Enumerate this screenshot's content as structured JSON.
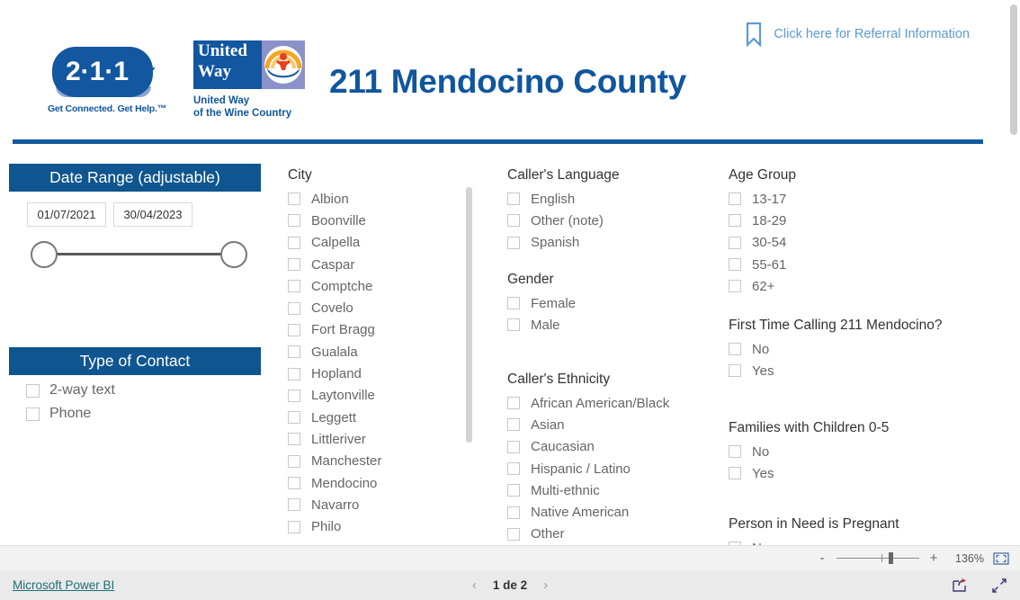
{
  "header": {
    "logo_211_text": "2·1·1",
    "logo_211_tagline": "Get Connected. Get Help.™",
    "united_way_line1": "United",
    "united_way_line2": "Way",
    "united_way_sub": "United Way\nof the Wine Country",
    "title": "211 Mendocino County",
    "referral_link": "Click here for Referral Information",
    "bookmark_icon": "bookmark-icon",
    "accent_blue": "#10569e",
    "link_blue": "#5b9bd5"
  },
  "date_range": {
    "title": "Date Range (adjustable)",
    "start": "01/07/2021",
    "end": "30/04/2023"
  },
  "type_of_contact": {
    "title": "Type of Contact",
    "options": [
      "2-way text",
      "Phone"
    ]
  },
  "city": {
    "title": "City",
    "options": [
      "Albion",
      "Boonville",
      "Calpella",
      "Caspar",
      "Comptche",
      "Covelo",
      "Fort Bragg",
      "Gualala",
      "Hopland",
      "Laytonville",
      "Leggett",
      "Littleriver",
      "Manchester",
      "Mendocino",
      "Navarro",
      "Philo"
    ]
  },
  "language": {
    "title": "Caller's Language",
    "options": [
      "English",
      "Other (note)",
      "Spanish"
    ]
  },
  "gender": {
    "title": "Gender",
    "options": [
      "Female",
      "Male"
    ]
  },
  "ethnicity": {
    "title": "Caller's Ethnicity",
    "options": [
      "African American/Black",
      "Asian",
      "Caucasian",
      "Hispanic / Latino",
      "Multi-ethnic",
      "Native American",
      "Other"
    ]
  },
  "age_group": {
    "title": "Age Group",
    "options": [
      "13-17",
      "18-29",
      "30-54",
      "55-61",
      "62+"
    ]
  },
  "first_time": {
    "title": "First Time Calling 211 Mendocino?",
    "options": [
      "No",
      "Yes"
    ]
  },
  "families": {
    "title": "Families with Children 0-5",
    "options": [
      "No",
      "Yes"
    ]
  },
  "pregnant": {
    "title": "Person in Need is Pregnant",
    "options": [
      "No"
    ]
  },
  "zoombar": {
    "minus": "-",
    "plus": "+",
    "percent": "136%",
    "fit_icon": "fit-to-page-icon"
  },
  "footer": {
    "powerbi_label": "Microsoft Power BI",
    "prev_icon": "chevron-left-icon",
    "page_label": "1 de 2",
    "next_icon": "chevron-right-icon",
    "share_icon": "share-icon",
    "fullscreen_icon": "fullscreen-icon"
  }
}
